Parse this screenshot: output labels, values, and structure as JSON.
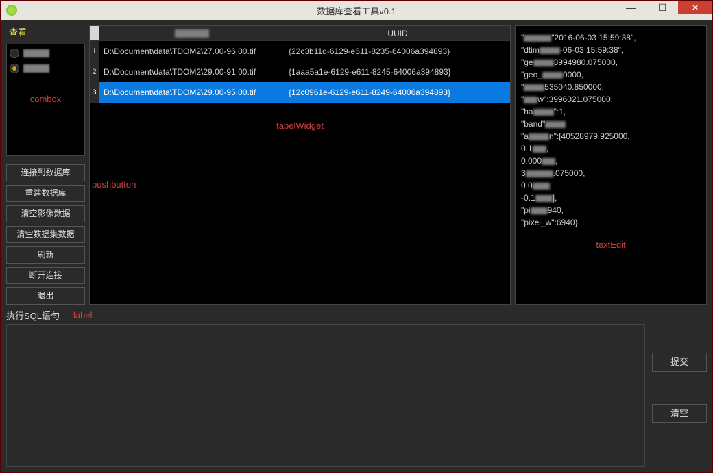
{
  "window": {
    "title": "数据库查看工具v0.1"
  },
  "left": {
    "view_label": "查看",
    "combox_annotation": "combox",
    "buttons": [
      "连接到数据库",
      "重建数据库",
      "清空影像数据",
      "清空数据集数据",
      "刷新",
      "断开连接",
      "退出"
    ],
    "pushbutton_annotation": "pushbutton"
  },
  "table": {
    "header_uuid": "UUID",
    "tablewidget_annotation": "tabelWidget",
    "rows": [
      {
        "num": "1",
        "path": "D:\\Document\\data\\TDOM2\\27.00-96.00.tif",
        "uuid": "{22c3b11d-6129-e611-8235-64006a394893}",
        "selected": false
      },
      {
        "num": "2",
        "path": "D:\\Document\\data\\TDOM2\\29.00-91.00.tif",
        "uuid": "{1aaa5a1e-6129-e611-8245-64006a394893}",
        "selected": false
      },
      {
        "num": "3",
        "path": "D:\\Document\\data\\TDOM2\\29.00-95.00.tif",
        "uuid": "{12c0961e-6129-e611-8249-64006a394893}",
        "selected": true
      }
    ]
  },
  "detail": {
    "textedit_annotation": "textEdit",
    "lines": [
      {
        "prefix": "\"",
        "blur": 40,
        "suffix": "\"2016-06-03 15:59:38\","
      },
      {
        "prefix": "\"dtim",
        "blur": 30,
        "suffix": "-06-03 15:59:38\","
      },
      {
        "prefix": "\"ge",
        "blur": 30,
        "suffix": "3994980.075000,"
      },
      {
        "prefix": "\"geo_",
        "blur": 30,
        "suffix": "0000,"
      },
      {
        "prefix": "\"",
        "blur": 30,
        "suffix": "535040.850000,"
      },
      {
        "prefix": "\"",
        "blur": 20,
        "suffix": "w\":3996021.075000,"
      },
      {
        "prefix": "\"ha",
        "blur": 30,
        "suffix": "\":1,"
      },
      {
        "prefix": "\"band\"",
        "blur": 30,
        "suffix": ""
      },
      {
        "prefix": "\"a",
        "blur": 30,
        "suffix": "n\":[40528979.925000,"
      },
      {
        "prefix": "0.1",
        "blur": 20,
        "suffix": ","
      },
      {
        "prefix": "0.000",
        "blur": 20,
        "suffix": ","
      },
      {
        "prefix": "3",
        "blur": 40,
        "suffix": ".075000,"
      },
      {
        "prefix": "0.0",
        "blur": 25,
        "suffix": ","
      },
      {
        "prefix": "-0.1",
        "blur": 25,
        "suffix": "],"
      },
      {
        "prefix": "\"pi",
        "blur": 25,
        "suffix": "940,"
      },
      {
        "prefix": "\"pixel_w\":6940}",
        "blur": 0,
        "suffix": ""
      }
    ]
  },
  "sql": {
    "label": "执行SQL语句",
    "label_annotation": "label",
    "submit": "提交",
    "clear": "清空"
  }
}
